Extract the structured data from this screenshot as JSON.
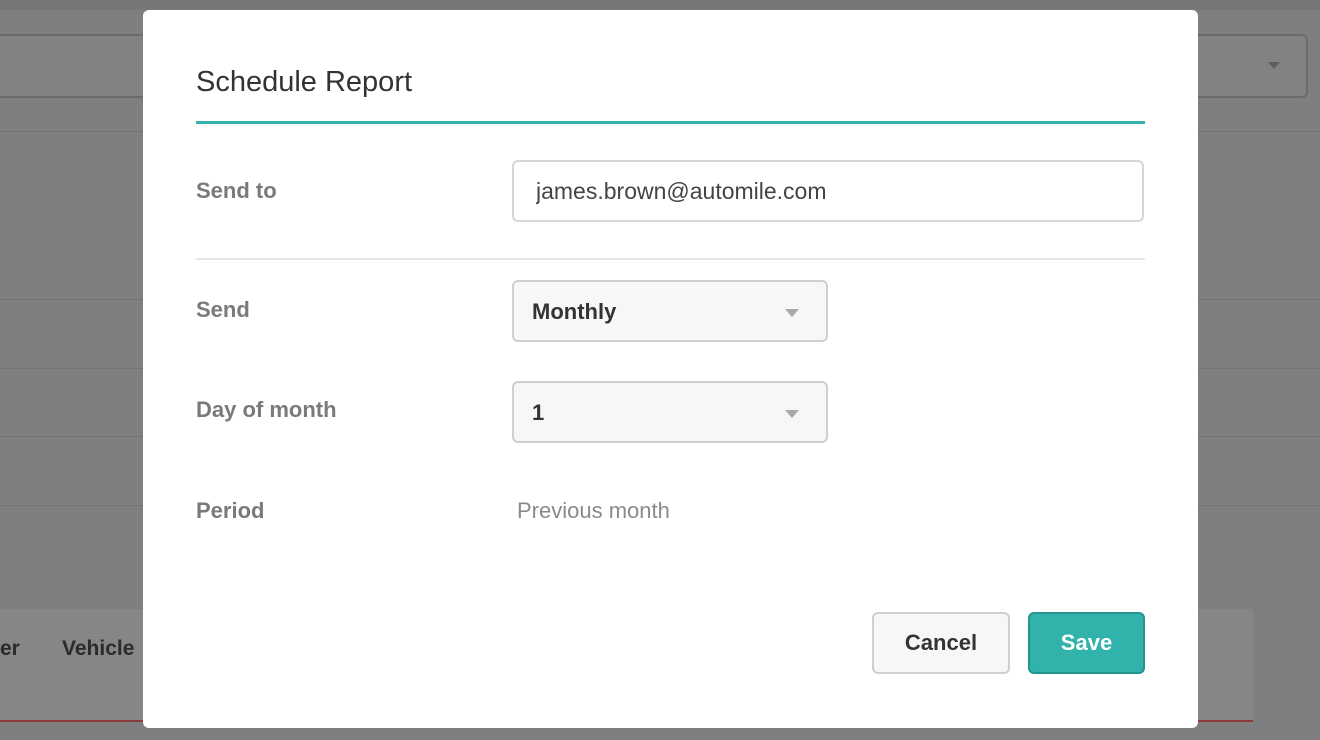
{
  "background": {
    "table_headers": [
      "er",
      "Vehicle"
    ]
  },
  "modal": {
    "title": "Schedule Report",
    "accent_color": "#31b3ac",
    "fields": {
      "send_to": {
        "label": "Send to",
        "value": "james.brown@automile.com"
      },
      "send": {
        "label": "Send",
        "selected": "Monthly",
        "icon": "chevron-down-icon"
      },
      "day_of_month": {
        "label": "Day of month",
        "selected": "1",
        "icon": "chevron-down-icon"
      },
      "period": {
        "label": "Period",
        "value": "Previous month"
      }
    },
    "buttons": {
      "cancel": "Cancel",
      "save": "Save"
    }
  }
}
